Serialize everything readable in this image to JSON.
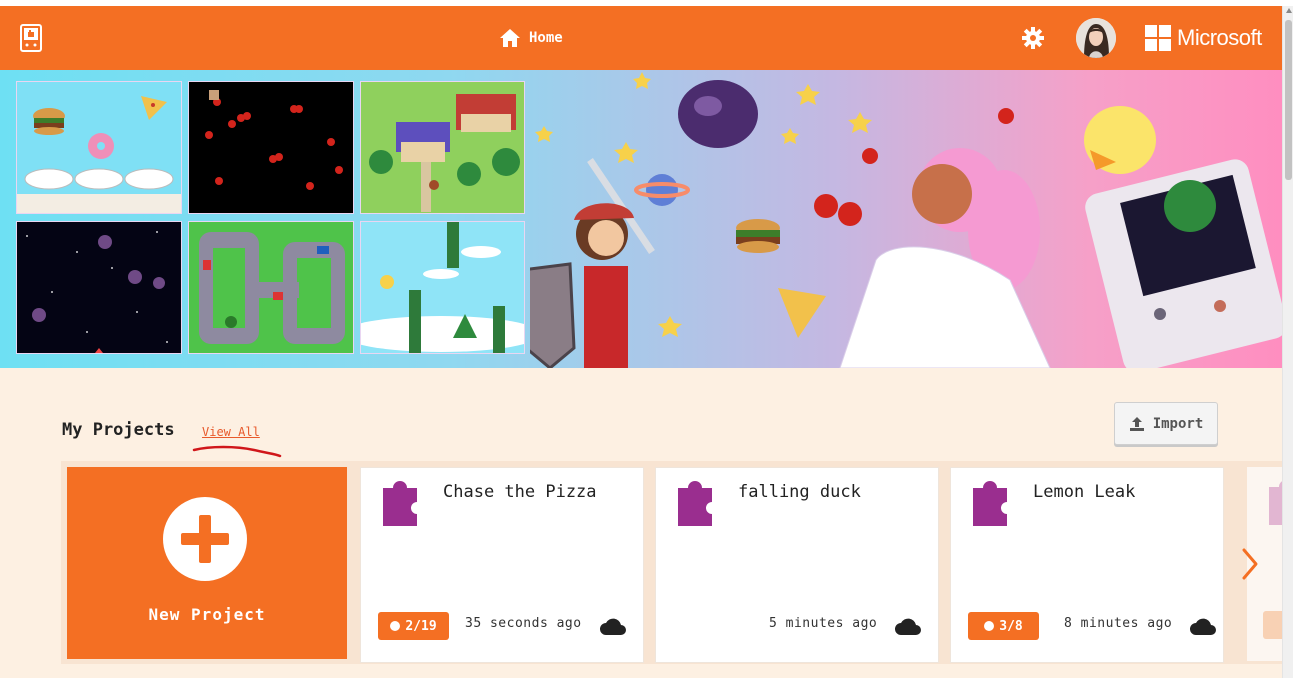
{
  "header": {
    "home_label": "Home",
    "brand_label": "Microsoft",
    "colors": {
      "accent": "#f46f23"
    },
    "icons": {
      "logo": "makecode-arcade-logo-icon",
      "home": "home-icon",
      "settings": "gear-icon",
      "brand": "microsoft-logo-icon"
    }
  },
  "hero": {
    "gallery": [
      {
        "name": "burger-plate-game-thumbnail"
      },
      {
        "name": "cherries-game-thumbnail"
      },
      {
        "name": "village-map-game-thumbnail"
      },
      {
        "name": "space-asteroids-game-thumbnail"
      },
      {
        "name": "race-track-game-thumbnail"
      },
      {
        "name": "flappy-duck-game-thumbnail"
      }
    ]
  },
  "projects": {
    "section_title": "My Projects",
    "view_all_label": "View All",
    "import_label": "Import",
    "new_project_label": "New Project",
    "items": [
      {
        "title": "Chase the Pizza",
        "badge": "2/19",
        "time": "35 seconds ago"
      },
      {
        "title": "falling duck",
        "badge": "",
        "time": "5 minutes ago"
      },
      {
        "title": "Lemon Leak",
        "badge": "3/8",
        "time": "8 minutes ago"
      }
    ]
  }
}
